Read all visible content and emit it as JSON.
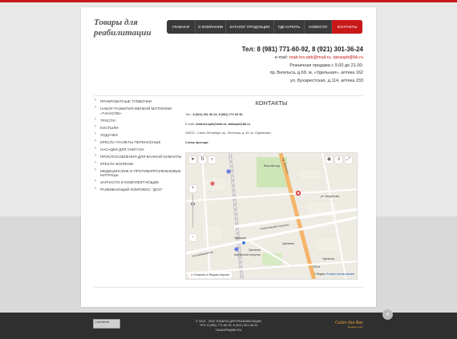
{
  "logo": {
    "line1": "Товары для",
    "line2": "реабилитации"
  },
  "nav": [
    "ГЛАВНАЯ",
    "О КОМПАНИИ",
    "КАТАЛОГ ПРОДУКЦИИ",
    "ГДЕ КУПИТЬ",
    "НОВОСТИ",
    "КОНТАКТЫ"
  ],
  "header_contacts": {
    "phone": "Тел: 8 (981) 771-60-92, 8 (921) 301-36-24",
    "email_label": "e-mail:",
    "email_value": "reab.tov.spb@mail.ru, tanaspb@bk.ru",
    "sales": "Розничная продажа с 9.00 до 21.00:",
    "addr1": "пр.Энгельса, д.69, м. «Удельная», аптека 162",
    "addr2": "ул. Бухарестская, д.114, аптека 233"
  },
  "sidebar": [
    "ПРИКРОВАТНЫЕ ТУМБОЧКИ",
    "НАБОР РАЗВИТИЯ МЕЛКОЙ МОТОРИКИ «ТАНАСПБ»",
    "ТРОСТИ",
    "КОСТЫЛИ",
    "ХОДУНКИ",
    "КРЕСЛА-ТУАЛЕТЫ ПЕРЕНОСНЫЕ",
    "НАСАДКИ ДЛЯ УНИТАЗА",
    "ПРИСПОСОБЛЕНИЯ ДЛЯ ВАННОЙ КОМНАТЫ",
    "КРЕСЛА-КОЛЯСКИ",
    "МЕДИЦИНСКИЕ И ПРОТИВОПРОЛЕЖНЕВЫЕ МАТРАЦЫ",
    "ЗАПЧАСТИ И КОМПЛЕКТУЮЩИЕ",
    "РАЗВИВАЮЩИЙ КОМПЛЕКС \"ДОН\""
  ],
  "main": {
    "title": "КОНТАКТЫ",
    "tel_label": "Тел.:",
    "tel_value": "8 (921) 301 36 24, 8 (981) 771 60 92",
    "email_label": "E-mail:",
    "email_value": "reab.tov.spb@mail.ru, tanaspb@bk.ru",
    "address": "194017, Санкт-Петербург, пр. Энгельса, д. 69, м. «Удельная»",
    "scheme": "Схема проезда:"
  },
  "map": {
    "labels": {
      "park": "Верхний сад",
      "prospect": "Скобелевский проспект",
      "udelnaya1": "Удельная",
      "udelnaya2": "Удельная",
      "udelnaya3": "Удельная",
      "udelnaya_st": "Удельная",
      "engels": "пр. Энгельса",
      "kolomyazhskaya": "Коломяжский пр.",
      "matrosova": "ул. Аккуратова",
      "kerch": "Кирпичный переулок"
    },
    "open_link": "Открыть в Яндекс Картах",
    "copyright": "© Яндекс",
    "terms": "Условия использования",
    "scale": "200 м",
    "zoom_in": "+",
    "zoom_out": "−"
  },
  "footer": {
    "copyright": "© 2013 - 2019 ТОВАРЫ ДЛЯ РЕАБИЛИТАЦИИ",
    "phones": "ТЕЛ: 8 (981) 771-60-92, 8 (921) 301-36-24",
    "email": "TANASPB@BK.RU",
    "counter": "LiveInternet",
    "site_title": "Сайт для Вас",
    "site_sub": "Заказать сайт"
  },
  "colors": {
    "accent": "#c81818",
    "nav_bg": "#3a3a3a",
    "footer_bg": "#2f2f2f",
    "road": "#f5b56a"
  }
}
